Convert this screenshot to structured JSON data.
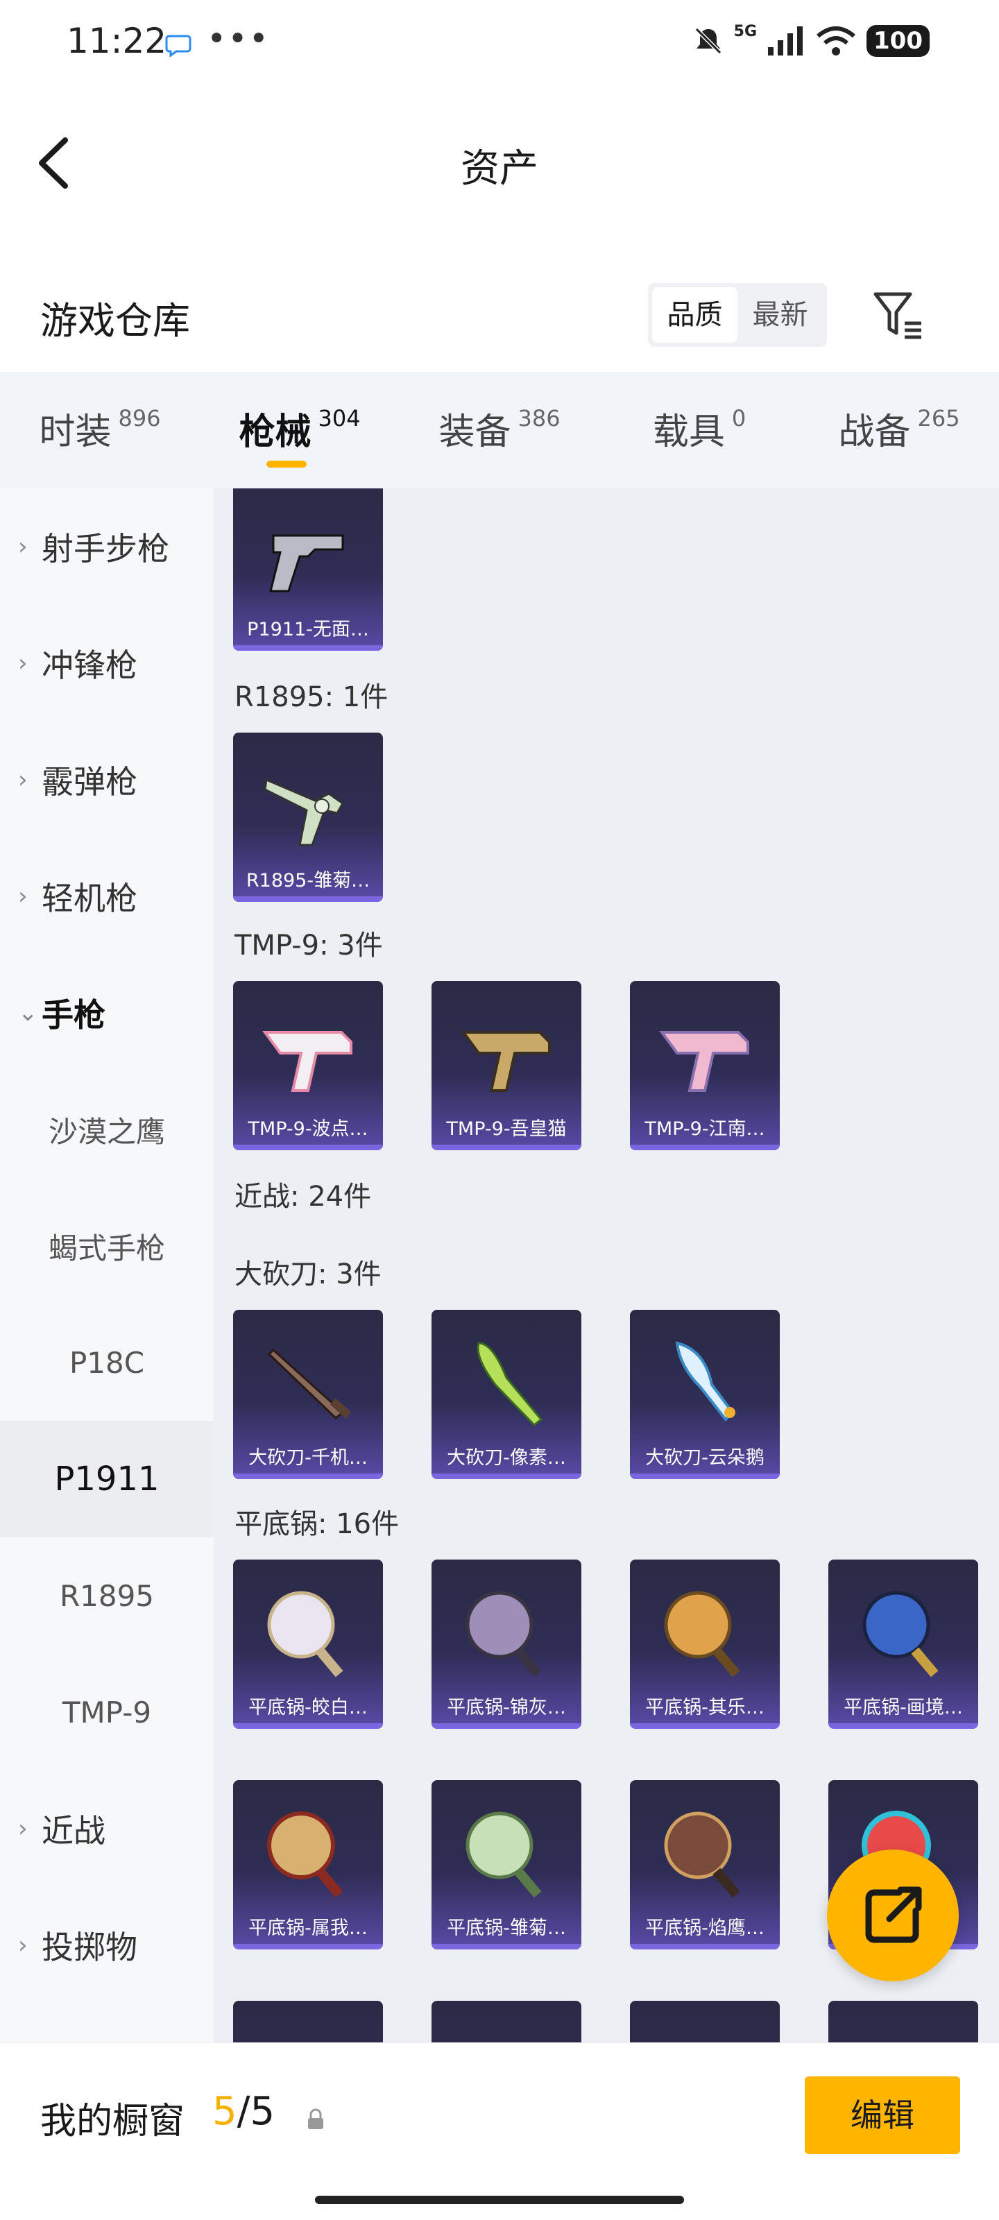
{
  "status_bar": {
    "time": "11:22",
    "network": "5G",
    "battery": "100",
    "dots": "•••"
  },
  "header": {
    "title": "资产"
  },
  "warehouse": {
    "title": "游戏仓库",
    "sort_options": [
      "品质",
      "最新"
    ]
  },
  "tabs": [
    {
      "label": "时装",
      "count": "896"
    },
    {
      "label": "枪械",
      "count": "304"
    },
    {
      "label": "装备",
      "count": "386"
    },
    {
      "label": "载具",
      "count": "0"
    },
    {
      "label": "战备",
      "count": "265"
    }
  ],
  "sidebar": {
    "items": [
      {
        "label": "射手步枪"
      },
      {
        "label": "冲锋枪"
      },
      {
        "label": "霰弹枪"
      },
      {
        "label": "轻机枪"
      },
      {
        "label": "手枪"
      },
      {
        "label": "沙漠之鹰"
      },
      {
        "label": "蝎式手枪"
      },
      {
        "label": "P18C"
      },
      {
        "label": "P1911"
      },
      {
        "label": "R1895"
      },
      {
        "label": "TMP-9"
      },
      {
        "label": "近战"
      },
      {
        "label": "投掷物"
      }
    ]
  },
  "content": {
    "sections": [
      {
        "label": "R1895: 1件"
      },
      {
        "label": "TMP-9: 3件"
      },
      {
        "label": "近战: 24件"
      },
      {
        "label": "大砍刀: 3件"
      },
      {
        "label": "平底锅: 16件"
      }
    ],
    "cards": [
      {
        "name": "P1911-无面…"
      },
      {
        "name": "R1895-雏菊…"
      },
      {
        "name": "TMP-9-波点…"
      },
      {
        "name": "TMP-9-吾皇猫"
      },
      {
        "name": "TMP-9-江南…"
      },
      {
        "name": "大砍刀-千机…"
      },
      {
        "name": "大砍刀-像素…"
      },
      {
        "name": "大砍刀-云朵鹅"
      },
      {
        "name": "平底锅-皎白…"
      },
      {
        "name": "平底锅-锦灰…"
      },
      {
        "name": "平底锅-其乐…"
      },
      {
        "name": "平底锅-画境…"
      },
      {
        "name": "平底锅-属我…"
      },
      {
        "name": "平底锅-雏菊…"
      },
      {
        "name": "平底锅-焰鹰…"
      }
    ]
  },
  "bottom_bar": {
    "label": "我的橱窗",
    "current": "5",
    "total": "/5",
    "edit_label": "编辑"
  },
  "colors": {
    "accent": "#ffb400",
    "card_bg": "#2f2d55",
    "card_edge": "#7a66e0"
  }
}
